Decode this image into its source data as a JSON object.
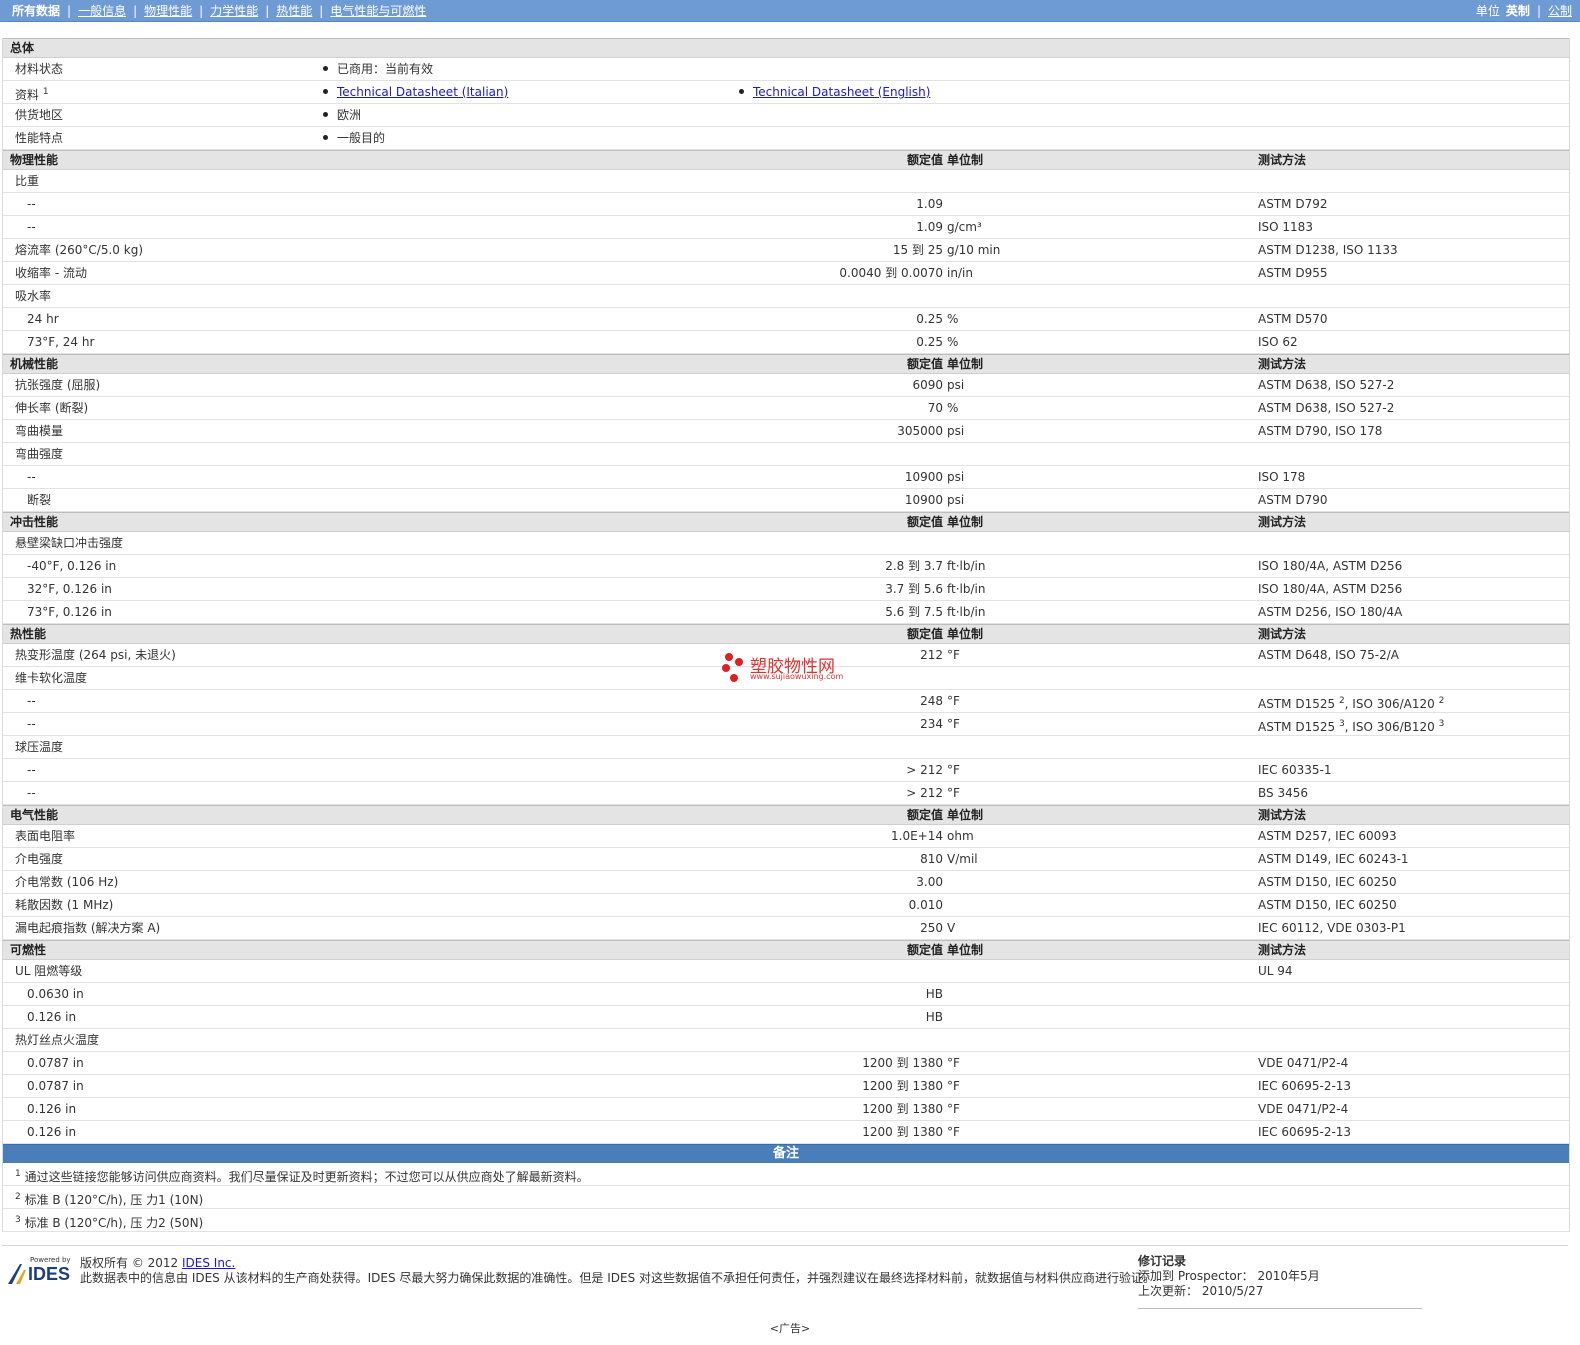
{
  "nav": {
    "items": [
      "所有数据",
      "一般信息",
      "物理性能",
      "力学性能",
      "热性能",
      "电气性能与可燃性"
    ],
    "unit_label": "单位",
    "units": [
      "英制",
      "公制"
    ]
  },
  "general": {
    "title": "总体",
    "status_label": "材料状态",
    "status_value": "已商用：当前有效",
    "docs_label": "资料",
    "docs_sup": "1",
    "doc_links": [
      "Technical Datasheet (Italian)",
      "Technical Datasheet (English)"
    ],
    "region_label": "供货地区",
    "region_value": "欧洲",
    "features_label": "性能特点",
    "features_value": "一般目的"
  },
  "headers": {
    "value": "额定值",
    "unit": "单位制",
    "method": "测试方法"
  },
  "physical": {
    "title": "物理性能",
    "sg_label": "比重",
    "sg1": {
      "label": "--",
      "value": "1.09",
      "unit": "",
      "method": "ASTM D792"
    },
    "sg2": {
      "label": "--",
      "value": "1.09",
      "unit": "g/cm³",
      "method": "ISO 1183"
    },
    "mfr": {
      "label": "熔流率",
      "cond": "(260°C/5.0 kg)",
      "value": "15 到  25",
      "unit": "g/10 min",
      "method": "ASTM D1238, ISO 1133"
    },
    "shrink": {
      "label": "收缩率",
      "cond": "- 流动",
      "value": "0.0040 到  0.0070",
      "unit": "in/in",
      "method": "ASTM D955"
    },
    "wa_label": "吸水率",
    "wa1": {
      "label": "24 hr",
      "value": "0.25",
      "unit": "%",
      "method": "ASTM D570"
    },
    "wa2": {
      "label": "73°F, 24 hr",
      "value": "0.25",
      "unit": "%",
      "method": "ISO 62"
    }
  },
  "mechanical": {
    "title": "机械性能",
    "tensile": {
      "label": "抗张强度",
      "cond": "(屈服)",
      "value": "6090",
      "unit": "psi",
      "method": "ASTM D638, ISO 527-2"
    },
    "elong": {
      "label": "伸长率",
      "cond": "(断裂)",
      "value": "70",
      "unit": "%",
      "method": "ASTM D638, ISO 527-2"
    },
    "flexmod": {
      "label": "弯曲模量",
      "value": "305000",
      "unit": "psi",
      "method": "ASTM D790, ISO 178"
    },
    "flexstr_label": "弯曲强度",
    "fs1": {
      "label": "--",
      "value": "10900",
      "unit": "psi",
      "method": "ISO 178"
    },
    "fs2": {
      "label": "断裂",
      "value": "10900",
      "unit": "psi",
      "method": "ASTM D790"
    }
  },
  "impact": {
    "title": "冲击性能",
    "izod_label": "悬壁梁缺口冲击强度",
    "i1": {
      "label": "-40°F, 0.126 in",
      "value": "2.8 到  3.7",
      "unit": "ft·lb/in",
      "method": "ISO 180/4A, ASTM D256"
    },
    "i2": {
      "label": "32°F, 0.126 in",
      "value": "3.7 到  5.6",
      "unit": "ft·lb/in",
      "method": "ISO 180/4A, ASTM D256"
    },
    "i3": {
      "label": "73°F, 0.126 in",
      "value": "5.6 到  7.5",
      "unit": "ft·lb/in",
      "method": "ASTM D256, ISO 180/4A"
    }
  },
  "thermal": {
    "title": "热性能",
    "hdt": {
      "label": "热变形温度",
      "cond": "(264 psi, 未退火)",
      "value": "212",
      "unit": "°F",
      "method": "ASTM D648, ISO 75-2/A"
    },
    "vicat_label": "维卡软化温度",
    "v1": {
      "label": "--",
      "value": "248",
      "unit": "°F",
      "method_a": "ASTM D1525",
      "sup_a": "2",
      "method_b": ", ISO 306/A120",
      "sup_b": "2"
    },
    "v2": {
      "label": "--",
      "value": "234",
      "unit": "°F",
      "method_a": "ASTM D1525",
      "sup_a": "3",
      "method_b": ", ISO 306/B120",
      "sup_b": "3"
    },
    "ball_label": "球压温度",
    "b1": {
      "label": "--",
      "value": "> 212",
      "unit": "°F",
      "method": "IEC 60335-1"
    },
    "b2": {
      "label": "--",
      "value": "> 212",
      "unit": "°F",
      "method": "BS 3456"
    }
  },
  "electrical": {
    "title": "电气性能",
    "sr": {
      "label": "表面电阻率",
      "value": "1.0E+14",
      "unit": "ohm",
      "method": "ASTM D257, IEC 60093"
    },
    "ds": {
      "label": "介电强度",
      "value": "810",
      "unit": "V/mil",
      "method": "ASTM D149, IEC 60243-1"
    },
    "dc": {
      "label": "介电常数",
      "cond": "(106 Hz)",
      "value": "3.00",
      "unit": "",
      "method": "ASTM D150, IEC 60250"
    },
    "df": {
      "label": "耗散因数",
      "cond": "(1 MHz)",
      "value": "0.010",
      "unit": "",
      "method": "ASTM D150, IEC 60250"
    },
    "cti": {
      "label": "漏电起痕指数",
      "cond": "(解决方案  A)",
      "value": "250",
      "unit": "V",
      "method": "IEC 60112, VDE 0303-P1"
    }
  },
  "flammability": {
    "title": "可燃性",
    "ul_label": "UL 阻燃等级",
    "ul_method": "UL 94",
    "u1": {
      "label": "0.0630 in",
      "value": "HB"
    },
    "u2": {
      "label": "0.126 in",
      "value": "HB"
    },
    "gw_label": "热灯丝点火温度",
    "g1": {
      "label": "0.0787 in",
      "value": "1200 到  1380",
      "unit": "°F",
      "method": "VDE 0471/P2-4"
    },
    "g2": {
      "label": "0.0787 in",
      "value": "1200 到  1380",
      "unit": "°F",
      "method": "IEC 60695-2-13"
    },
    "g3": {
      "label": "0.126 in",
      "value": "1200 到  1380",
      "unit": "°F",
      "method": "VDE 0471/P2-4"
    },
    "g4": {
      "label": "0.126 in",
      "value": "1200 到  1380",
      "unit": "°F",
      "method": "IEC 60695-2-13"
    }
  },
  "notes": {
    "title": "备注",
    "items": [
      {
        "num": "1",
        "text": "通过这些链接您能够访问供应商资料。我们尽量保证及时更新资料；不过您可以从供应商处了解最新资料。"
      },
      {
        "num": "2",
        "text": "标准  B (120°C/h), 压  力1 (10N)"
      },
      {
        "num": "3",
        "text": "标准  B (120°C/h), 压  力2 (50N)"
      }
    ]
  },
  "watermark": {
    "text": "塑胶物性网",
    "url": "www.sujiaowuxing.com"
  },
  "footer": {
    "logo_powered": "Powered by",
    "logo_text": "IDES",
    "copyright_prefix": "版权所有  © 2012 ",
    "copyright_link": "IDES Inc.",
    "disclaimer": "此数据表中的信息由  IDES 从该材料的生产商处获得。IDES 尽最大努力确保此数据的准确性。但是  IDES 对这些数据值不承担任何责任，并强烈建议在最终选择材料前，就数据值与材料供应商进行验证。",
    "revision_title": "修订记录",
    "added_label": "添加到  Prospector：",
    "added_value": "2010年5月",
    "updated_label": "上次更新：",
    "updated_value": "2010/5/27"
  },
  "ad": "<广告>"
}
